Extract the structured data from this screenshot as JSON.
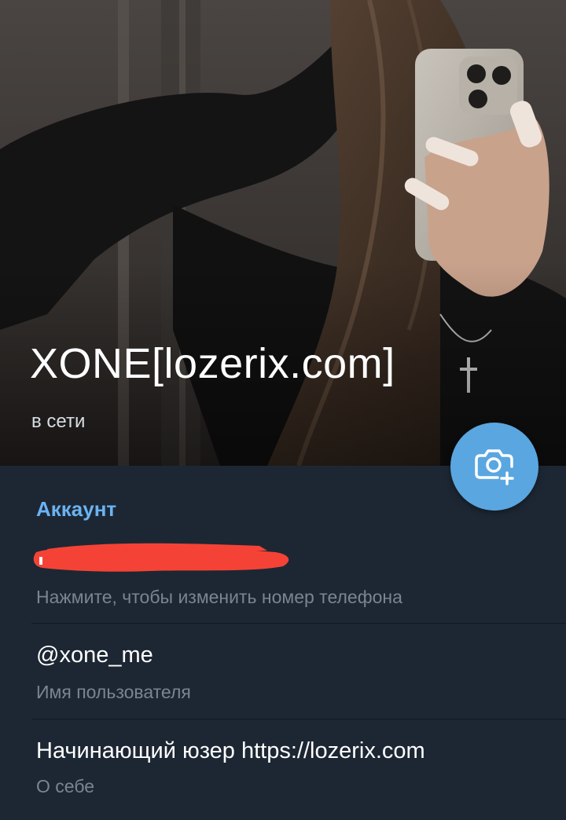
{
  "profile": {
    "name": "XONE[lozerix.com]",
    "status": "в сети"
  },
  "camera_button": {
    "icon": "camera-add-icon"
  },
  "account": {
    "section_title": "Аккаунт",
    "phone": {
      "value": "",
      "caption": "Нажмите, чтобы изменить номер телефона",
      "redaction_color": "#f44336"
    },
    "username": {
      "value": "@xone_me",
      "caption": "Имя пользователя"
    },
    "bio": {
      "value": "Начинающий юзер https://lozerix.com",
      "caption": "О себе"
    }
  },
  "colors": {
    "accent": "#6ab3f3",
    "fab": "#5aa6e0",
    "background": "#1d2733",
    "secondary_text": "#7a8591"
  }
}
